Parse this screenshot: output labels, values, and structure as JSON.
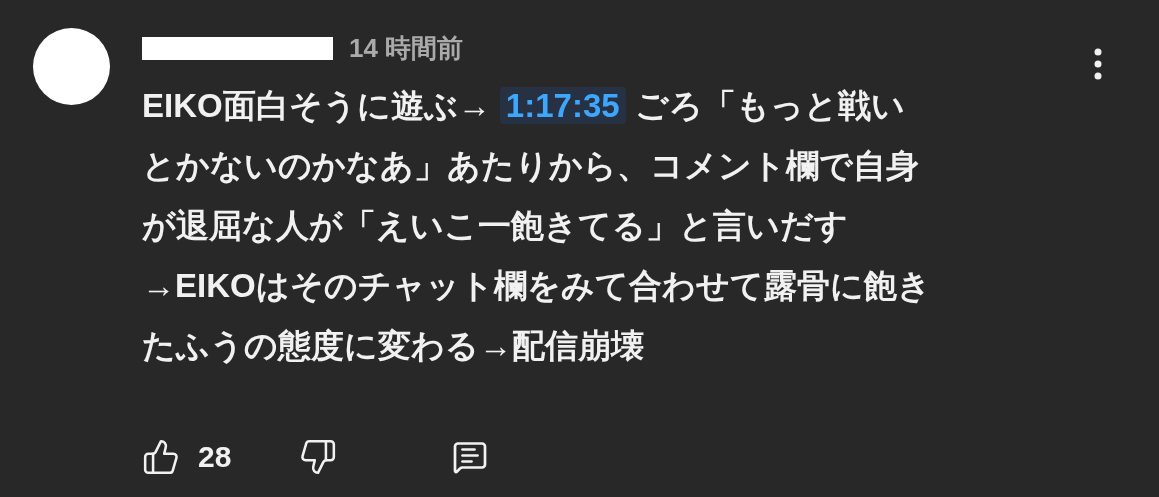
{
  "comment": {
    "time": "14 時間前",
    "before": "EIKO面白そうに遊ぶ→",
    "timestamp": "1:17:35",
    "after_lines": [
      "ごろ「もっと戦い",
      "とかないのかなあ」あたりから、コメント欄で自身",
      "が退屈な人が「えいこ一飽きてる」と言いだす",
      "→EIKOはそのチャット欄をみて合わせて露骨に飽き",
      "たふうの態度に変わる→配信崩壊"
    ],
    "likes": "28"
  }
}
